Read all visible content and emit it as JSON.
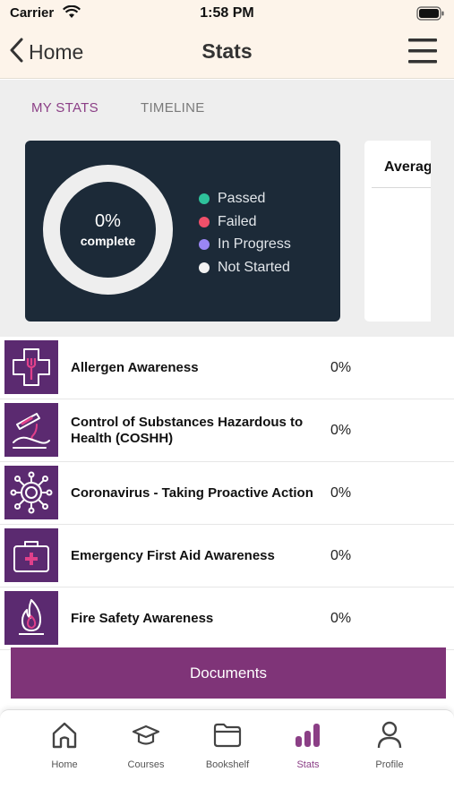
{
  "status_bar": {
    "carrier": "Carrier",
    "time": "1:58 PM"
  },
  "nav": {
    "back_label": "Home",
    "title": "Stats"
  },
  "tabs": [
    {
      "label": "MY STATS",
      "active": true
    },
    {
      "label": "TIMELINE",
      "active": false
    }
  ],
  "summary": {
    "percent": "0%",
    "subtitle": "complete",
    "legend": [
      {
        "label": "Passed",
        "color": "#2ec29b"
      },
      {
        "label": "Failed",
        "color": "#f0506a"
      },
      {
        "label": "In Progress",
        "color": "#9a86f4"
      },
      {
        "label": "Not Started",
        "color": "#f2f2f2"
      }
    ]
  },
  "side_card": {
    "title": "Average"
  },
  "courses": [
    {
      "title": "Allergen Awareness",
      "percent": "0%",
      "icon": "allergen-icon"
    },
    {
      "title": "Control of Substances Hazardous to Health (COSHH)",
      "percent": "0%",
      "icon": "coshh-icon"
    },
    {
      "title": "Coronavirus - Taking Proactive Action",
      "percent": "0%",
      "icon": "coronavirus-icon"
    },
    {
      "title": "Emergency First Aid Awareness",
      "percent": "0%",
      "icon": "first-aid-kit-icon"
    },
    {
      "title": "Fire Safety Awareness",
      "percent": "0%",
      "icon": "fire-icon"
    }
  ],
  "documents_button": "Documents",
  "tab_bar": [
    {
      "label": "Home",
      "icon": "home-icon",
      "active": false
    },
    {
      "label": "Courses",
      "icon": "graduation-cap-icon",
      "active": false
    },
    {
      "label": "Bookshelf",
      "icon": "folder-icon",
      "active": false
    },
    {
      "label": "Stats",
      "icon": "bar-chart-icon",
      "active": true
    },
    {
      "label": "Profile",
      "icon": "person-icon",
      "active": false
    }
  ],
  "colors": {
    "accent": "#8b3f86",
    "course_icon_bg": "#5b2a70",
    "card_bg": "#1c2a38",
    "header_bg": "#fdf4ea"
  }
}
